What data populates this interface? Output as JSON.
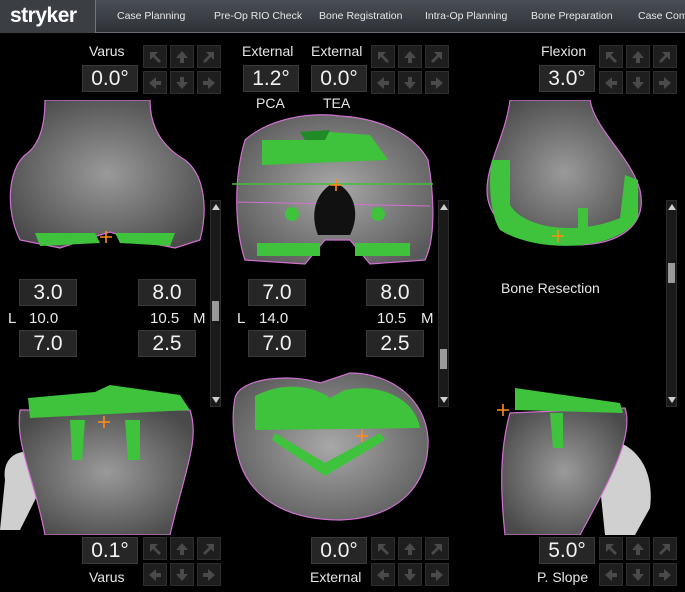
{
  "app": {
    "brand": "stryker"
  },
  "nav": {
    "tabs": [
      "Case Planning",
      "Pre-Op RIO Check",
      "Bone Registration",
      "Intra-Op Planning",
      "Bone Preparation",
      "Case Comp"
    ]
  },
  "femur": {
    "varus": {
      "label": "Varus",
      "value": "0.0°"
    },
    "external_pca": {
      "label": "External",
      "value": "1.2°",
      "sublabel": "PCA"
    },
    "external_tea": {
      "label": "External",
      "value": "0.0°",
      "sublabel": "TEA"
    },
    "flexion": {
      "label": "Flexion",
      "value": "3.0°"
    }
  },
  "gaps": {
    "left_panel": {
      "top": "3.0",
      "mid": "10.0",
      "bottom": "7.0"
    },
    "left_panel_right": {
      "top": "8.0",
      "mid": "10.5",
      "bottom": "2.5"
    },
    "center_panel": {
      "top": "7.0",
      "mid": "14.0",
      "bottom": "7.0"
    },
    "center_panel_right": {
      "top": "8.0",
      "mid": "10.5",
      "bottom": "2.5"
    },
    "l_label": "L",
    "m_label": "M"
  },
  "bone_resection": "Bone Resection",
  "tibia": {
    "varus": {
      "label": "Varus",
      "value": "0.1°"
    },
    "external": {
      "label": "External",
      "value": "0.0°"
    },
    "slope": {
      "label": "P. Slope",
      "value": "5.0°"
    }
  },
  "colors": {
    "implant": "#3fc23c",
    "implant_dark": "#1f8a26",
    "outline": "#c060c0",
    "landmark": "#ff8c1a",
    "button_bg": "#1e1e1e"
  },
  "icons": {
    "pad": [
      "arrow-up-left-icon",
      "arrow-up-icon",
      "arrow-up-right-icon",
      "arrow-left-icon",
      "arrow-down-icon",
      "arrow-right-icon"
    ]
  }
}
